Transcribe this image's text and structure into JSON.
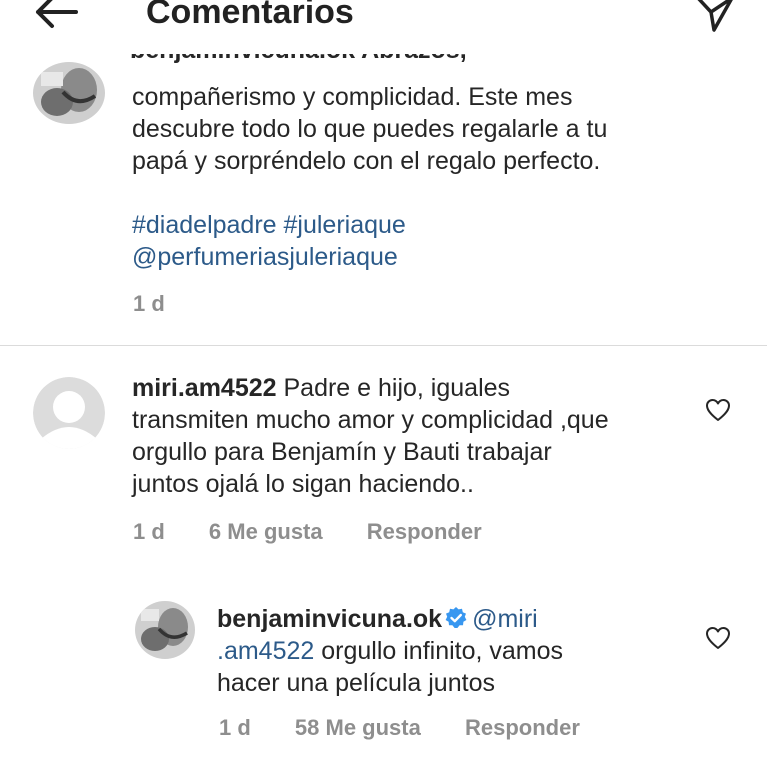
{
  "header": {
    "title": "Comentarios"
  },
  "caption": {
    "truncated_line": "benjaminvicuna.ok Abrazos,",
    "lines": [
      "compañerismo y complicidad. Este mes",
      "descubre todo lo que puedes regalarle a tu",
      "papá y sorpréndelo con el regalo perfecto."
    ],
    "hashtags": "#diadelpadre #juleriaque",
    "mention": "@perfumeriasjuleriaque",
    "time": "1 d"
  },
  "comment": {
    "username": "miri.am4522",
    "text_line1": " Padre e hijo, iguales",
    "line2": "transmiten mucho amor y complicidad ,que",
    "line3": "orgullo para Benjamín y Bauti trabajar",
    "line4": "juntos ojalá lo sigan haciendo..",
    "time": "1 d",
    "likes": "6 Me gusta",
    "reply": "Responder"
  },
  "reply": {
    "username": "benjaminvicuna.ok",
    "mention_part1": "@miri",
    "mention_part2": ".am4522",
    "text_line2": " orgullo infinito, vamos",
    "line3": "hacer una película juntos",
    "time": "1 d",
    "likes": "58 Me gusta",
    "reply": "Responder"
  },
  "colors": {
    "text": "#262626",
    "meta": "#8e8e8e",
    "link": "#2c5a89",
    "verified": "#3897f0",
    "divider": "#dbdbdb"
  }
}
